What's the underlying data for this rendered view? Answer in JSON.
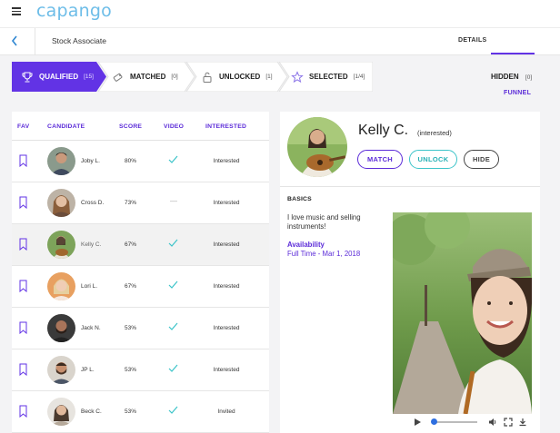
{
  "app": {
    "logo_text": "capango",
    "menu_icon": "hamburger-icon"
  },
  "header": {
    "back_icon": "chevron-left-icon",
    "job_title": "Stock Associate",
    "tabs": [
      {
        "label": "DETAILS",
        "active": false
      },
      {
        "label": "FUNNEL",
        "active": true
      }
    ]
  },
  "funnel": {
    "steps": [
      {
        "label": "QUALIFIED",
        "count": "[15]",
        "icon": "trophy-icon",
        "active": true
      },
      {
        "label": "MATCHED",
        "count": "[0]",
        "icon": "puzzle-icon",
        "active": false
      },
      {
        "label": "UNLOCKED",
        "count": "[1]",
        "icon": "unlock-icon",
        "active": false
      },
      {
        "label": "SELECTED",
        "count": "[1/4]",
        "icon": "star-icon",
        "active": false
      }
    ],
    "hidden": {
      "label": "HIDDEN",
      "count": "[0]"
    }
  },
  "table": {
    "columns": [
      "FAV",
      "CANDIDATE",
      "SCORE",
      "VIDEO",
      "INTERESTED"
    ],
    "rows": [
      {
        "name": "Joby L.",
        "score": "80%",
        "video": true,
        "interested": "Interested"
      },
      {
        "name": "Cross D.",
        "score": "73%",
        "video": false,
        "interested": "Interested"
      },
      {
        "name": "Kelly C.",
        "score": "67%",
        "video": true,
        "interested": "Interested"
      },
      {
        "name": "Lori L.",
        "score": "67%",
        "video": true,
        "interested": "Interested"
      },
      {
        "name": "Jack N.",
        "score": "53%",
        "video": true,
        "interested": "Interested"
      },
      {
        "name": "JP L.",
        "score": "53%",
        "video": true,
        "interested": "Interested"
      },
      {
        "name": "Beck C.",
        "score": "53%",
        "video": true,
        "interested": "Invited"
      }
    ],
    "no_video_mark": "—"
  },
  "profile": {
    "name": "Kelly C.",
    "status": "(interested)",
    "buttons": {
      "match": "MATCH",
      "unlock": "UNLOCK",
      "hide": "HIDE"
    },
    "basics_heading": "BASICS",
    "about": "I love music and selling instruments!",
    "availability_label": "Availability",
    "availability_value": "Full Time - Mar 1, 2018"
  },
  "colors": {
    "primary": "#6233e5",
    "accent": "#3cc4c9",
    "logo": "#6dbde8"
  }
}
